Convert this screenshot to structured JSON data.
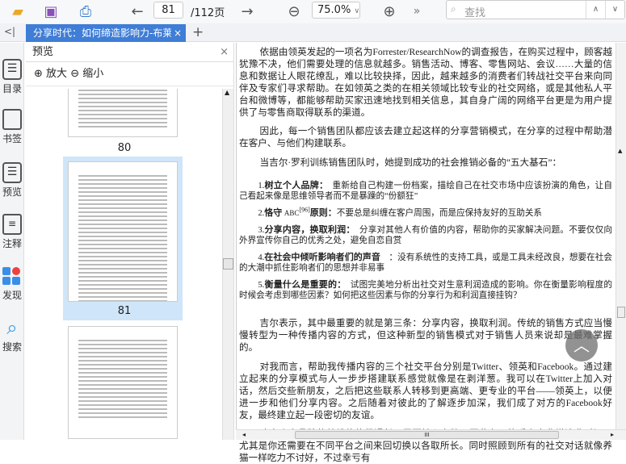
{
  "toolbar": {
    "current_page": "81",
    "total_pages": "/112页",
    "zoom": "75.0%",
    "search_placeholder": "查找",
    "more": "»"
  },
  "tab": {
    "title": "分享时代：如何缔造影响力-布莱",
    "close": "×",
    "add": "+",
    "collapse": "<|"
  },
  "rail": [
    {
      "label": "目录"
    },
    {
      "label": "书签"
    },
    {
      "label": "预览"
    },
    {
      "label": "注释"
    },
    {
      "label": "发现"
    },
    {
      "label": "搜索"
    }
  ],
  "panel": {
    "title": "预览",
    "close": "×",
    "zoom_in": "放大",
    "zoom_out": "缩小",
    "pages": [
      "80",
      "81"
    ]
  },
  "doc": {
    "p1": "依据由领英发起的一项名为Forrester/ResearchNow的调查报告，在购买过程中，顾客越犹豫不决，他们需要处理的信息就越多。销售活动、博客、零售网站、会议……大量的信息和数据让人眼花缭乱，难以比较抉择，因此，越来越多的消费者们转战社交平台来向同伴及专家们寻求帮助。在如领英之类的在相关领域比较专业的社交网络，或是其他私人平台和微博等，都能够帮助买家迅速地找到相关信息，其自身广阔的网络平台更是为用户提供了与零售商取得联系的渠道。",
    "p2": "因此，每一个销售团队都应该去建立起这样的分享营销模式，在分享的过程中帮助潜在客户、与他们构建联系。",
    "p3": "当吉尔·罗利训练销售团队时，她提到成功的社会推销必备的“五大基石”：",
    "list": [
      {
        "num": "1.",
        "title": "树立个人品牌：",
        "text": "　重新给自己构建一份档案，描绘自己在社交市场中应该扮演的角色，让自己看起来像是思维领导者而不是暴躁的“份额狂”"
      },
      {
        "num": "2.",
        "title": "恪守",
        "abc": "ABC",
        "sup": "[96]",
        "title2": "原则：",
        "text": "不要总是纠缠在客户周围，而是应保持友好的互助关系"
      },
      {
        "num": "3.",
        "title": "分享内容，换取利润：",
        "text": "　分享对其他人有价值的内容，帮助你的买家解决问题。不要仅仅向外界宣传你自己的优秀之处，避免自恋自赏"
      },
      {
        "num": "4.",
        "title": "在社会中倾听影响者们的声音",
        "text": "　：没有系统性的支持工具，或是工具未经改良，想要在社会的大潮中抓住影响者们的思想并非易事"
      },
      {
        "num": "5.",
        "title": "衡量什么是重要的：",
        "text": "　试图完美地分析出社交对生意利润造成的影响。你在衡量影响程度的时候会考虑到哪些因素？如何把这些因素与你的分享行为和利润直接挂钩？"
      }
    ],
    "p4": "吉尔表示，其中最重要的就是第三条：分享内容，换取利润。传统的销售方式应当慢慢转型为一种传播内容的方式，但这种新型的销售模式对于销售人员来说却是最难掌握的。",
    "p5": "对我而言，帮助我传播内容的三个社交平台分别是Twitter、领英和Facebook。通过建立起来的分享模式与人一步步搭建联系感觉就像是在剥洋葱。我可以在Twitter上加入对话，然后交些新朋友，之后把这些联系人转移到更高端、更专业的平台——领英上，以便进一步和他们分享内容。之后随着对彼此的了解逐步加深，我们成了对方的Facebook好友，最终建立起一段密切的友谊。",
    "p6": "建立个人品牌的战线往往很漫长，需要精心布阵，因此有可能看上去非常浪费时间，尤其是你还需要在不同平台之间来回切换以各取所长。同时照顾到所有的社交对话就像养猫一样吃力不讨好，不过幸亏有"
  },
  "hscroll_grip": "III",
  "colors": {
    "accent": "#3f7dd6",
    "selection": "#cfe5f9"
  }
}
